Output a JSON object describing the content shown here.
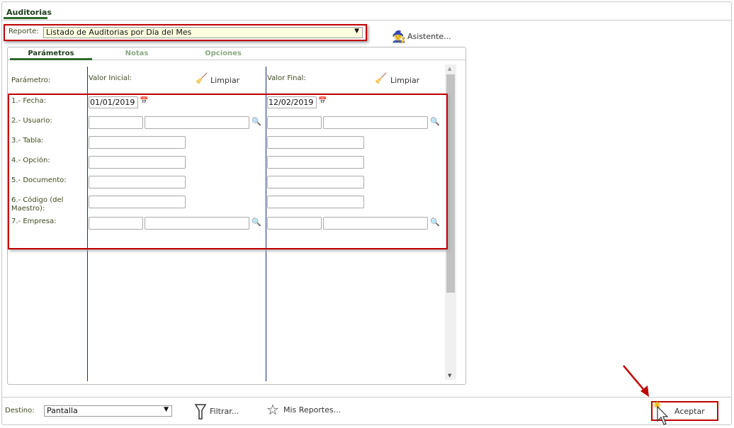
{
  "window": {
    "tab": "Auditorias"
  },
  "report": {
    "label": "Reporte:",
    "value": "Listado de Auditorias por Día del Mes",
    "wizard": "Asistente..."
  },
  "tabs": [
    {
      "label": "Parámetros",
      "active": true
    },
    {
      "label": "Notas"
    },
    {
      "label": "Opciones"
    }
  ],
  "headers": {
    "param": "Parámetro:",
    "initial": "Valor Inicial:",
    "final": "Valor Final:",
    "clear": "Limpiar"
  },
  "params": [
    {
      "label": "1.- Fecha:",
      "initial": "01/01/2019",
      "final": "12/02/2019"
    },
    {
      "label": "2.- Usuario:"
    },
    {
      "label": "3.- Tabla:"
    },
    {
      "label": "4.- Opción:"
    },
    {
      "label": "5.- Documento:"
    },
    {
      "label": "6.- Código (del Maestro):"
    },
    {
      "label": "7.- Empresa:"
    }
  ],
  "footer": {
    "dest_label": "Destino:",
    "dest_value": "Pantalla",
    "filter": "Filtrar...",
    "my_reports": "Mis Reportes...",
    "accept": "Aceptar"
  },
  "colors": {
    "accent": "#2e6b2e",
    "highlight": "#c00000"
  }
}
